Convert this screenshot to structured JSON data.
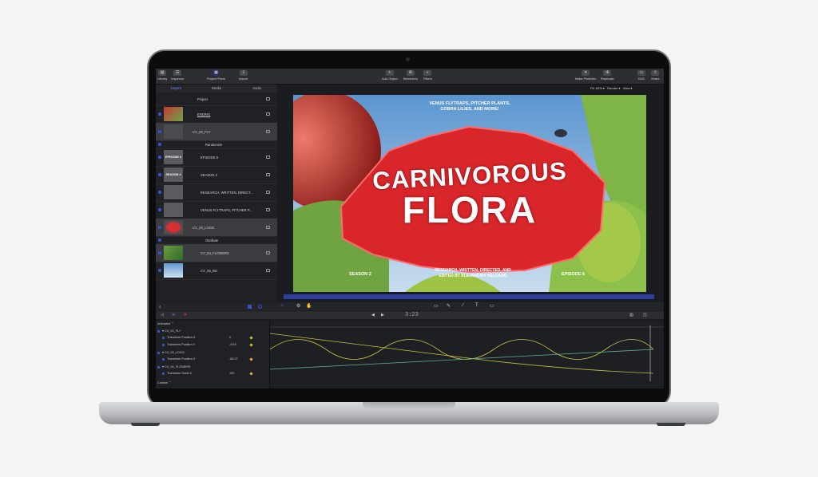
{
  "toolbar": {
    "library": "Library",
    "inspector": "Inspector",
    "project_pane": "Project Pane",
    "import": "Import",
    "add_object": "Add Object",
    "behaviors": "Behaviors",
    "filters": "Filters",
    "make_particles": "Make Particles",
    "replicate": "Replicate",
    "hud": "HUD",
    "share": "Share"
  },
  "viewer_bar": {
    "fit": "Fit: 62%",
    "render": "Render",
    "view": "View"
  },
  "panel_tabs": [
    "Layers",
    "Media",
    "Audio"
  ],
  "layers": [
    {
      "label": "Project",
      "thumb": ""
    },
    {
      "label": "ENDING",
      "thumb": ""
    },
    {
      "label": "CV_02_FLY",
      "thumb": ""
    },
    {
      "label": "Randomize",
      "thumb": ""
    },
    {
      "label": "EPISODE 6",
      "thumb": "EPISODE 6"
    },
    {
      "label": "SEASON 2",
      "thumb": "SEASON 2"
    },
    {
      "label": "RESEARCH, WRITTEN, DIRECT...",
      "thumb": ""
    },
    {
      "label": "VENUS FLYTRAPS, PITCHER P...",
      "thumb": ""
    },
    {
      "label": "CV_03_LOGO",
      "thumb": ""
    },
    {
      "label": "Oscillate",
      "thumb": ""
    },
    {
      "label": "CV_04_FLOWERS",
      "thumb": ""
    },
    {
      "label": "CV_05_BG",
      "thumb": ""
    }
  ],
  "canvas": {
    "top_text_1": "VENUS FLYTRAPS, PITCHER PLANTS,",
    "top_text_2": "COBRA LILIES, AND MORE!",
    "title_1": "CARNIVOROUS",
    "title_2": "FLORA",
    "season": "SEASON 2",
    "credit_1": "RESEARCH, WRITTEN, DIRECTED, AND",
    "credit_2": "EDITED BY ALEJANDRO DELGADO",
    "episode": "EPISODE 6"
  },
  "timeline": {
    "timecode": "3:23",
    "animated_label": "Animated",
    "custom_label": "Custom"
  },
  "keyframe_rows": [
    {
      "label": "CV_02_FLY",
      "value": ""
    },
    {
      "label": "Transform.Position.X",
      "value": "0"
    },
    {
      "label": "Transform.Position.Y",
      "value": "-3.63"
    },
    {
      "label": "CV_03_LOGO",
      "value": ""
    },
    {
      "label": "Transform.Position.X",
      "value": "-80.07"
    },
    {
      "label": "CV_04_FLOWERS",
      "value": ""
    },
    {
      "label": "Transform.Scale.X",
      "value": "100"
    }
  ],
  "colors": {
    "accent": "#3a51c4",
    "title_red": "#d8262a",
    "curve_yellow": "#c7c04a",
    "curve_green": "#5fb49a"
  }
}
